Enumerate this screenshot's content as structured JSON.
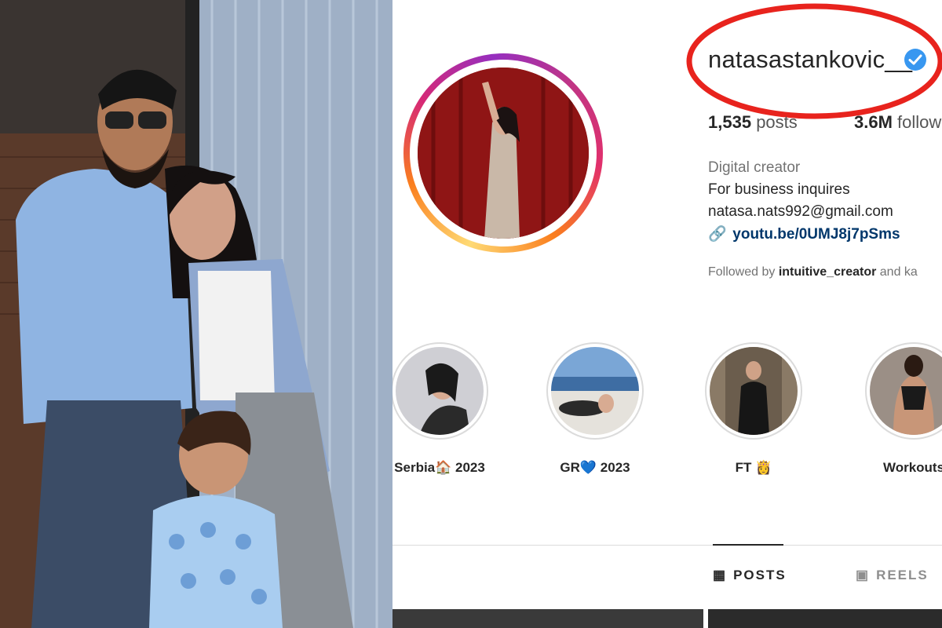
{
  "profile": {
    "username": "natasastankovic__",
    "verified": true,
    "stats": {
      "posts_value": "1,535",
      "posts_label": "posts",
      "followers_value": "3.6M",
      "followers_label": "follow"
    },
    "category": "Digital creator",
    "bio": [
      "For business inquires",
      "natasa.nats992@gmail.com"
    ],
    "link": "youtu.be/0UMJ8j7pSms",
    "followed_by_prefix": "Followed by",
    "followed_by_user": "intuitive_creator",
    "followed_by_suffix": "and ka"
  },
  "highlights": [
    {
      "label": "Serbia🏠 2023",
      "icon": "highlight-serbia"
    },
    {
      "label": "GR💙 2023",
      "icon": "highlight-gr"
    },
    {
      "label": "FT 👸",
      "icon": "highlight-ft"
    },
    {
      "label": "Workouts",
      "icon": "highlight-workouts"
    }
  ],
  "tabs": [
    {
      "label": "POSTS",
      "icon": "grid-icon",
      "active": true
    },
    {
      "label": "REELS",
      "icon": "reels-icon",
      "active": false
    }
  ],
  "colors": {
    "annotation": "#e8231d",
    "verified_badge": "#3897f0",
    "link": "#00376b",
    "muted_text": "#737373"
  }
}
